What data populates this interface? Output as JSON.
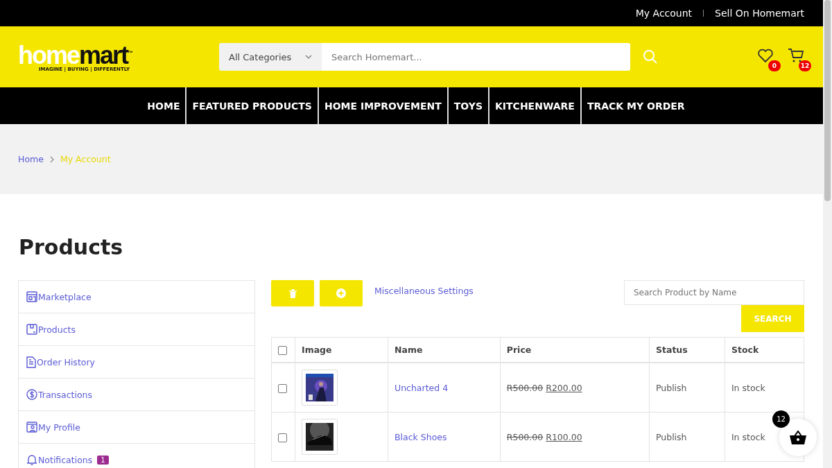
{
  "top_links": [
    "My Account",
    "Sell On Homemart"
  ],
  "logo": {
    "part1": "home",
    "part2": "mart",
    "tm": "™",
    "tagline": "IMAGINE | BUYING | DIFFERENTLY"
  },
  "search": {
    "category": "All Categories",
    "placeholder": "Search Homemart..."
  },
  "wishlist_count": "0",
  "cart_count": "12",
  "nav": [
    "HOME",
    "FEATURED PRODUCTS",
    "HOME IMPROVEMENT",
    "TOYS",
    "KITCHENWARE",
    "TRACK MY ORDER"
  ],
  "breadcrumb": [
    {
      "label": "Home",
      "selected": false
    },
    {
      "label": "My Account",
      "selected": true
    }
  ],
  "page_title": "Products",
  "sidebar": [
    {
      "label": "Marketplace",
      "kind": "store"
    },
    {
      "label": "Products",
      "kind": "box"
    },
    {
      "label": "Order History",
      "kind": "doc"
    },
    {
      "label": "Transactions",
      "kind": "dollar"
    },
    {
      "label": "My Profile",
      "kind": "profile"
    },
    {
      "label": "Notifications",
      "kind": "bell",
      "badge": "1"
    }
  ],
  "toolbar": {
    "link": "Miscellaneous Settings",
    "search_placeholder": "Search Product by Name",
    "search_button": "SEARCH"
  },
  "table": {
    "select_all_checked": false,
    "columns": [
      "Image",
      "Name",
      "Price",
      "Status",
      "Stock"
    ],
    "rows": [
      {
        "checked": false,
        "name": "Uncharted 4",
        "old_price": "R500.00",
        "price": "R200.00",
        "status": "Publish",
        "stock": "In stock"
      },
      {
        "checked": false,
        "name": "Black Shoes",
        "old_price": "R500.00",
        "price": "R100.00",
        "status": "Publish",
        "stock": "In stock"
      }
    ]
  },
  "floating_cart_count": "12"
}
